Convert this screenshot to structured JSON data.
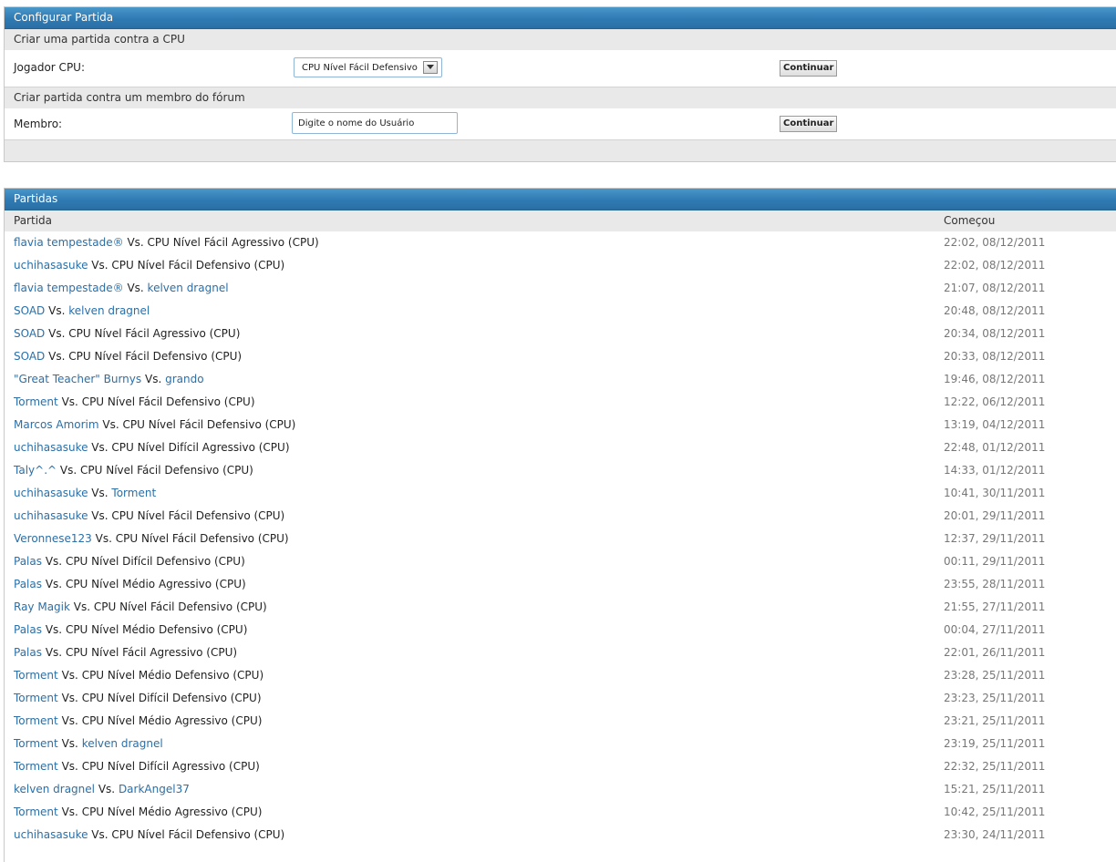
{
  "setup": {
    "title": "Configurar Partida",
    "cpu_section": "Criar uma partida contra a CPU",
    "cpu_label": "Jogador CPU:",
    "cpu_selected": "CPU Nível Fácil Defensivo",
    "member_section": "Criar partida contra um membro do fórum",
    "member_label": "Membro:",
    "member_value": "Digite o nome do Usuário",
    "continue_label": "Continuar"
  },
  "matches": {
    "title": "Partidas",
    "col_match": "Partida",
    "col_started": "Começou",
    "rows": [
      {
        "p1": "flavia tempestade®",
        "p2": "CPU Nível Fácil Agressivo (CPU)",
        "p2_link": false,
        "date": "22:02, 08/12/2011"
      },
      {
        "p1": "uchihasasuke",
        "p2": "CPU Nível Fácil Defensivo (CPU)",
        "p2_link": false,
        "date": "22:02, 08/12/2011"
      },
      {
        "p1": "flavia tempestade®",
        "p2": "kelven dragnel",
        "p2_link": true,
        "date": "21:07, 08/12/2011"
      },
      {
        "p1": "SOAD",
        "p2": "kelven dragnel",
        "p2_link": true,
        "date": "20:48, 08/12/2011"
      },
      {
        "p1": "SOAD",
        "p2": "CPU Nível Fácil Agressivo (CPU)",
        "p2_link": false,
        "date": "20:34, 08/12/2011"
      },
      {
        "p1": "SOAD",
        "p2": "CPU Nível Fácil Defensivo (CPU)",
        "p2_link": false,
        "date": "20:33, 08/12/2011"
      },
      {
        "p1": "\"Great Teacher\" Burnys",
        "p2": "grando",
        "p2_link": true,
        "date": "19:46, 08/12/2011"
      },
      {
        "p1": "Torment",
        "p2": "CPU Nível Fácil Defensivo (CPU)",
        "p2_link": false,
        "date": "12:22, 06/12/2011"
      },
      {
        "p1": "Marcos Amorim",
        "p2": "CPU Nível Fácil Defensivo (CPU)",
        "p2_link": false,
        "date": "13:19, 04/12/2011"
      },
      {
        "p1": "uchihasasuke",
        "p2": "CPU Nível Difícil Agressivo (CPU)",
        "p2_link": false,
        "date": "22:48, 01/12/2011"
      },
      {
        "p1": "Taly^.^",
        "p2": "CPU Nível Fácil Defensivo (CPU)",
        "p2_link": false,
        "date": "14:33, 01/12/2011"
      },
      {
        "p1": "uchihasasuke",
        "p2": "Torment",
        "p2_link": true,
        "date": "10:41, 30/11/2011"
      },
      {
        "p1": "uchihasasuke",
        "p2": "CPU Nível Fácil Defensivo (CPU)",
        "p2_link": false,
        "date": "20:01, 29/11/2011"
      },
      {
        "p1": "Veronnese123",
        "p2": "CPU Nível Fácil Defensivo (CPU)",
        "p2_link": false,
        "date": "12:37, 29/11/2011"
      },
      {
        "p1": "Palas",
        "p2": "CPU Nível Difícil Defensivo (CPU)",
        "p2_link": false,
        "date": "00:11, 29/11/2011"
      },
      {
        "p1": "Palas",
        "p2": "CPU Nível Médio Agressivo (CPU)",
        "p2_link": false,
        "date": "23:55, 28/11/2011"
      },
      {
        "p1": "Ray Magik",
        "p2": "CPU Nível Fácil Defensivo (CPU)",
        "p2_link": false,
        "date": "21:55, 27/11/2011"
      },
      {
        "p1": "Palas",
        "p2": "CPU Nível Médio Defensivo (CPU)",
        "p2_link": false,
        "date": "00:04, 27/11/2011"
      },
      {
        "p1": "Palas",
        "p2": "CPU Nível Fácil Agressivo (CPU)",
        "p2_link": false,
        "date": "22:01, 26/11/2011"
      },
      {
        "p1": "Torment",
        "p2": "CPU Nível Médio Defensivo (CPU)",
        "p2_link": false,
        "date": "23:28, 25/11/2011"
      },
      {
        "p1": "Torment",
        "p2": "CPU Nível Difícil Defensivo (CPU)",
        "p2_link": false,
        "date": "23:23, 25/11/2011"
      },
      {
        "p1": "Torment",
        "p2": "CPU Nível Médio Agressivo (CPU)",
        "p2_link": false,
        "date": "23:21, 25/11/2011"
      },
      {
        "p1": "Torment",
        "p2": "kelven dragnel",
        "p2_link": true,
        "date": "23:19, 25/11/2011"
      },
      {
        "p1": "Torment",
        "p2": "CPU Nível Difícil Agressivo (CPU)",
        "p2_link": false,
        "date": "22:32, 25/11/2011"
      },
      {
        "p1": "kelven dragnel",
        "p2": "DarkAngel37",
        "p2_link": true,
        "date": "15:21, 25/11/2011"
      },
      {
        "p1": "Torment",
        "p2": "CPU Nível Médio Agressivo (CPU)",
        "p2_link": false,
        "date": "10:42, 25/11/2011"
      },
      {
        "p1": "uchihasasuke",
        "p2": "CPU Nível Fácil Defensivo (CPU)",
        "p2_link": false,
        "date": "23:30, 24/11/2011"
      }
    ]
  },
  "vs_label": "Vs."
}
